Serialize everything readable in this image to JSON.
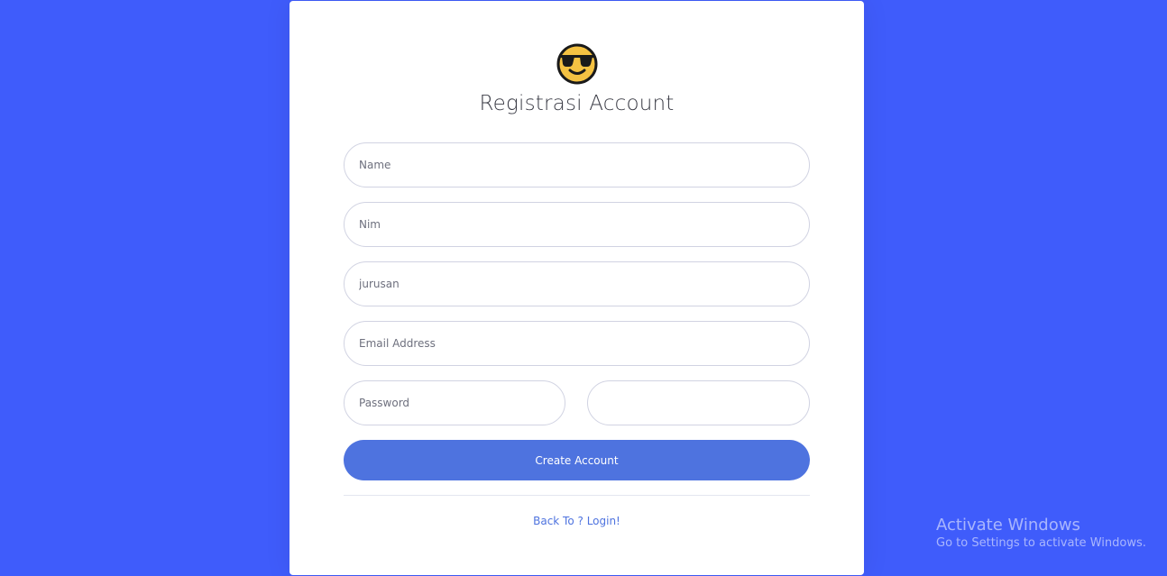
{
  "form": {
    "title": "Registrasi Account",
    "emoji_icon": "smiling-face-with-sunglasses-icon",
    "fields": {
      "name_placeholder": "Name",
      "nim_placeholder": "Nim",
      "jurusan_placeholder": "jurusan",
      "email_placeholder": "Email Address",
      "password_placeholder": "Password",
      "repeat_password_placeholder": ""
    },
    "submit_label": "Create Account",
    "login_link": "Back To ? Login!"
  },
  "watermark": {
    "title": "Activate Windows",
    "subtitle": "Go to Settings to activate Windows."
  },
  "colors": {
    "background": "#3f5cfb",
    "card": "#ffffff",
    "primary_button": "#4e73df",
    "link": "#4e73df",
    "emoji_face": "#f5c242"
  }
}
